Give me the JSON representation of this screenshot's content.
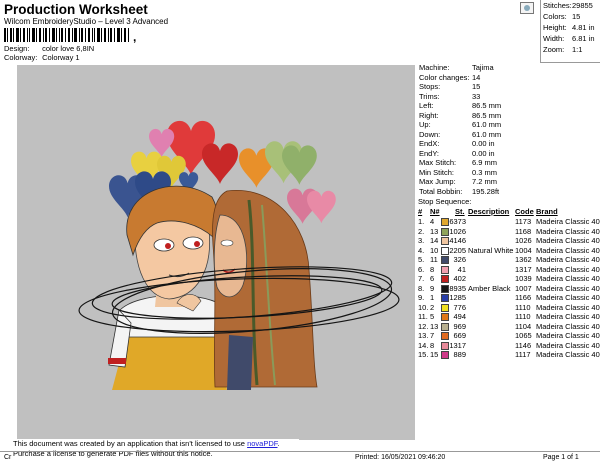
{
  "header": {
    "title": "Production Worksheet",
    "subtitle": "Wilcom EmbroideryStudio – Level 3 Advanced",
    "design_label": "Design:",
    "design_value": "color love 6,8IN",
    "colorway_label": "Colorway:",
    "colorway_value": "Colorway 1",
    "barcode_suffix": ","
  },
  "topstats": [
    {
      "k": "Stitches:",
      "v": "29855"
    },
    {
      "k": "Colors:",
      "v": "15"
    },
    {
      "k": "Height:",
      "v": "4.81 in"
    },
    {
      "k": "Width:",
      "v": "6.81 in"
    },
    {
      "k": "Zoom:",
      "v": "1:1"
    }
  ],
  "machine": [
    {
      "k": "Machine:",
      "v": "Tajima"
    },
    {
      "k": "Color changes:",
      "v": "14"
    },
    {
      "k": "Stops:",
      "v": "15"
    },
    {
      "k": "Trims:",
      "v": "33"
    },
    {
      "k": "Left:",
      "v": "86.5 mm"
    },
    {
      "k": "Right:",
      "v": "86.5 mm"
    },
    {
      "k": "Up:",
      "v": "61.0 mm"
    },
    {
      "k": "Down:",
      "v": "61.0 mm"
    },
    {
      "k": "EndX:",
      "v": "0.00 in"
    },
    {
      "k": "EndY:",
      "v": "0.00 in"
    },
    {
      "k": "Max Stitch:",
      "v": "6.9 mm"
    },
    {
      "k": "Min Stitch:",
      "v": "0.3 mm"
    },
    {
      "k": "Max Jump:",
      "v": "7.2 mm"
    },
    {
      "k": "Total Bobbin:",
      "v": "195.28ft"
    }
  ],
  "stop_sequence": {
    "title": "Stop Sequence:",
    "headers": {
      "num": "#",
      "n": "N#",
      "st": "St.",
      "desc": "Description",
      "code": "Code",
      "brand": "Brand"
    },
    "rows": [
      {
        "num": "1.",
        "n": "4",
        "color": "#e0a830",
        "st": "6373",
        "desc": "",
        "code": "1173",
        "brand": "Madeira Classic 40"
      },
      {
        "num": "2.",
        "n": "13",
        "color": "#8fa35a",
        "st": "1026",
        "desc": "",
        "code": "1168",
        "brand": "Madeira Classic 40"
      },
      {
        "num": "3.",
        "n": "14",
        "color": "#f0c6a0",
        "st": "4146",
        "desc": "",
        "code": "1026",
        "brand": "Madeira Classic 40"
      },
      {
        "num": "4.",
        "n": "10",
        "color": "#ffffff",
        "st": "2205",
        "desc": "Natural White",
        "code": "1004",
        "brand": "Madeira Classic 40"
      },
      {
        "num": "5.",
        "n": "11",
        "color": "#404a6a",
        "st": "326",
        "desc": "",
        "code": "1362",
        "brand": "Madeira Classic 40"
      },
      {
        "num": "6.",
        "n": "8",
        "color": "#f0a0b0",
        "st": "41",
        "desc": "",
        "code": "1317",
        "brand": "Madeira Classic 40"
      },
      {
        "num": "7.",
        "n": "6",
        "color": "#c02020",
        "st": "402",
        "desc": "",
        "code": "1039",
        "brand": "Madeira Classic 40"
      },
      {
        "num": "8.",
        "n": "9",
        "color": "#151515",
        "st": "8935",
        "desc": "Amber Black",
        "code": "1007",
        "brand": "Madeira Classic 40"
      },
      {
        "num": "9.",
        "n": "1",
        "color": "#2a3fa8",
        "st": "1285",
        "desc": "",
        "code": "1166",
        "brand": "Madeira Classic 40"
      },
      {
        "num": "10.",
        "n": "2",
        "color": "#f0e020",
        "st": "776",
        "desc": "",
        "code": "1110",
        "brand": "Madeira Classic 40"
      },
      {
        "num": "11.",
        "n": "5",
        "color": "#e07818",
        "st": "494",
        "desc": "",
        "code": "1110",
        "brand": "Madeira Classic 40"
      },
      {
        "num": "12.",
        "n": "13",
        "color": "#b8b090",
        "st": "969",
        "desc": "",
        "code": "1104",
        "brand": "Madeira Classic 40"
      },
      {
        "num": "13.",
        "n": "7",
        "color": "#e06a20",
        "st": "669",
        "desc": "",
        "code": "1065",
        "brand": "Madeira Classic 40"
      },
      {
        "num": "14.",
        "n": "8",
        "color": "#e88a9a",
        "st": "1317",
        "desc": "",
        "code": "1146",
        "brand": "Madeira Classic 40"
      },
      {
        "num": "15.",
        "n": "15",
        "color": "#d03a8a",
        "st": "889",
        "desc": "",
        "code": "1117",
        "brand": "Madeira Classic 40"
      }
    ]
  },
  "footer": {
    "left": "Cr",
    "printed": "Printed:  16/05/2021 09:46:20",
    "page": "Page 1 of 1"
  },
  "notice": {
    "line1": "This document was created by an application that isn't licensed to use ",
    "link": "novaPDF",
    "line1_end": ".",
    "line2": "Purchase a license to generate PDF files without this notice."
  }
}
